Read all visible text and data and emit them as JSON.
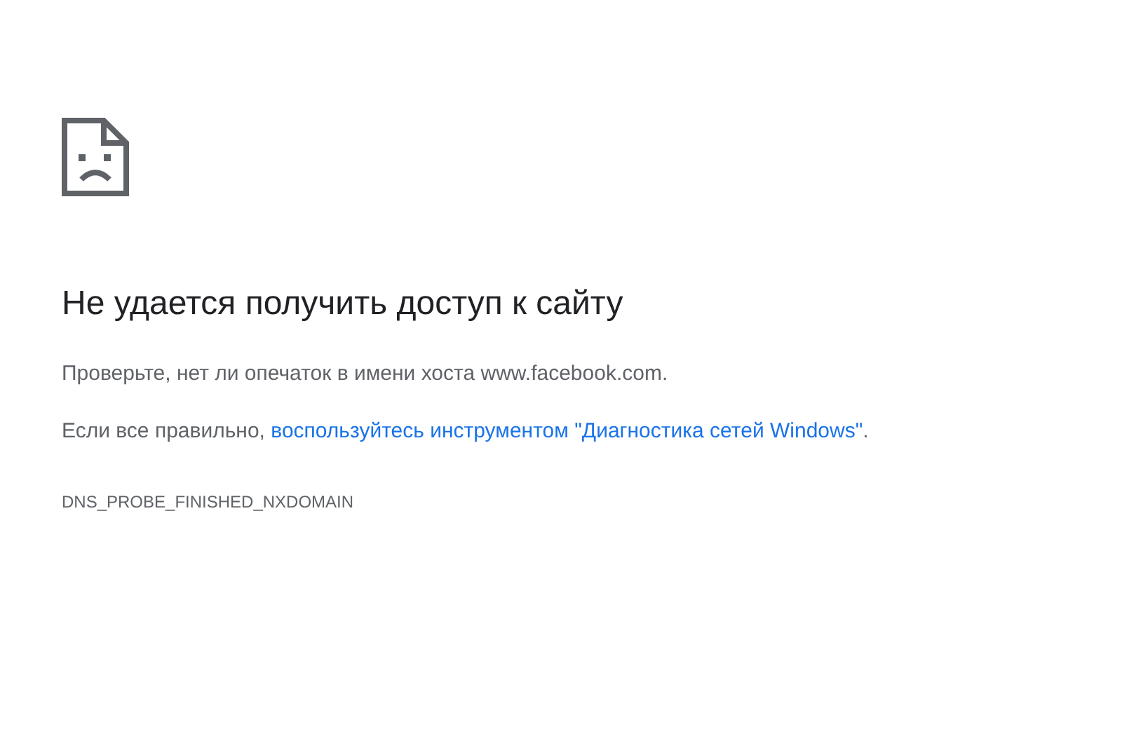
{
  "title": "Не удается получить доступ к сайту",
  "hint": "Проверьте, нет ли опечаток в имени хоста www.facebook.com.",
  "suggestion": {
    "before": "Если все правильно, ",
    "link": "воспользуйтесь инструментом \"Диагностика сетей Windows\"",
    "after": "."
  },
  "error_code": "DNS_PROBE_FINISHED_NXDOMAIN"
}
